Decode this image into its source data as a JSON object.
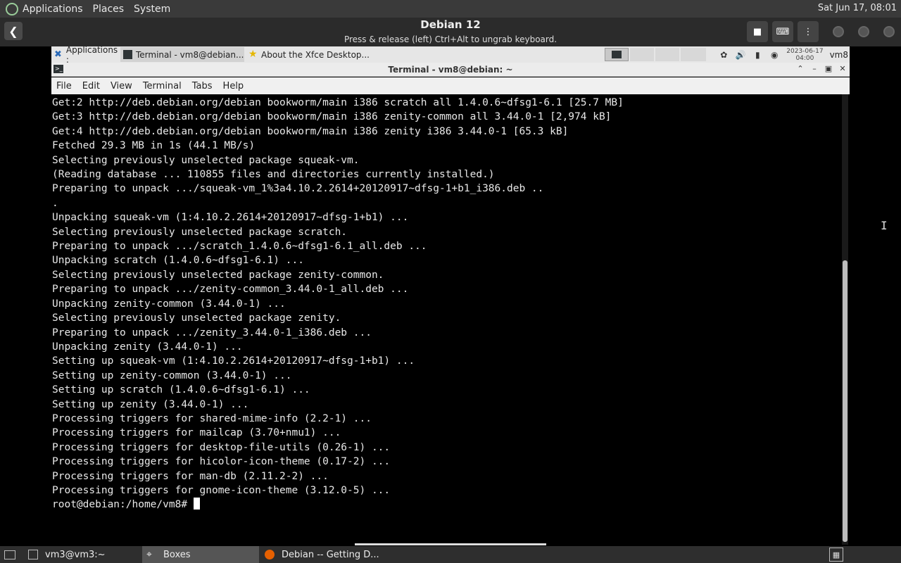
{
  "host_panel": {
    "menus": [
      "Applications",
      "Places",
      "System"
    ],
    "clock": "Sat Jun 17, 08:01"
  },
  "boxes": {
    "title": "Debian 12",
    "subtitle": "Press & release (left) Ctrl+Alt to ungrab keyboard."
  },
  "guest_panel": {
    "tasks": [
      {
        "label": "Applications :",
        "icon": "xfce-icon"
      },
      {
        "label": "Terminal - vm8@debian...",
        "icon": "terminal-icon"
      },
      {
        "label": "About the Xfce Desktop...",
        "icon": "star-icon"
      }
    ],
    "clock_date": "2023-06-17",
    "clock_time": "04:00",
    "user": "vm8"
  },
  "terminal": {
    "title": "Terminal - vm8@debian: ~",
    "menu": [
      "File",
      "Edit",
      "View",
      "Terminal",
      "Tabs",
      "Help"
    ],
    "lines": [
      "Get:2 http://deb.debian.org/debian bookworm/main i386 scratch all 1.4.0.6~dfsg1-6.1 [25.7 MB]",
      "Get:3 http://deb.debian.org/debian bookworm/main i386 zenity-common all 3.44.0-1 [2,974 kB]",
      "Get:4 http://deb.debian.org/debian bookworm/main i386 zenity i386 3.44.0-1 [65.3 kB]",
      "Fetched 29.3 MB in 1s (44.1 MB/s)",
      "Selecting previously unselected package squeak-vm.",
      "(Reading database ... 110855 files and directories currently installed.)",
      "Preparing to unpack .../squeak-vm_1%3a4.10.2.2614+20120917~dfsg-1+b1_i386.deb ..",
      ".",
      "Unpacking squeak-vm (1:4.10.2.2614+20120917~dfsg-1+b1) ...",
      "Selecting previously unselected package scratch.",
      "Preparing to unpack .../scratch_1.4.0.6~dfsg1-6.1_all.deb ...",
      "Unpacking scratch (1.4.0.6~dfsg1-6.1) ...",
      "Selecting previously unselected package zenity-common.",
      "Preparing to unpack .../zenity-common_3.44.0-1_all.deb ...",
      "Unpacking zenity-common (3.44.0-1) ...",
      "Selecting previously unselected package zenity.",
      "Preparing to unpack .../zenity_3.44.0-1_i386.deb ...",
      "Unpacking zenity (3.44.0-1) ...",
      "Setting up squeak-vm (1:4.10.2.2614+20120917~dfsg-1+b1) ...",
      "Setting up zenity-common (3.44.0-1) ...",
      "Setting up scratch (1.4.0.6~dfsg1-6.1) ...",
      "Setting up zenity (3.44.0-1) ...",
      "Processing triggers for shared-mime-info (2.2-1) ...",
      "Processing triggers for mailcap (3.70+nmu1) ...",
      "Processing triggers for desktop-file-utils (0.26-1) ...",
      "Processing triggers for hicolor-icon-theme (0.17-2) ...",
      "Processing triggers for man-db (2.11.2-2) ...",
      "Processing triggers for gnome-icon-theme (3.12.0-5) ..."
    ],
    "prompt": "root@debian:/home/vm8# "
  },
  "host_taskbar": {
    "tasks": [
      {
        "label": "vm3@vm3:~",
        "icon": "terminal-icon"
      },
      {
        "label": "Boxes",
        "icon": "boxes-icon"
      },
      {
        "label": "Debian -- Getting D...",
        "icon": "firefox-icon"
      }
    ]
  }
}
